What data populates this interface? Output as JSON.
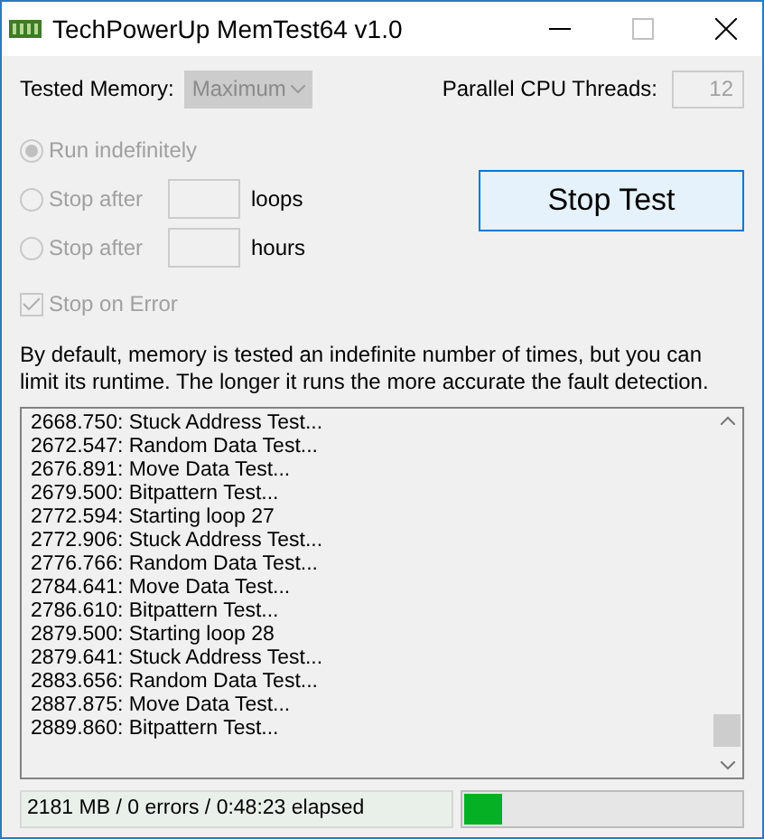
{
  "window": {
    "title": "TechPowerUp MemTest64 v1.0"
  },
  "tested_memory": {
    "label": "Tested Memory:",
    "value": "Maximum",
    "disabled": true
  },
  "threads": {
    "label": "Parallel CPU Threads:",
    "value": "12",
    "disabled": true
  },
  "run_options": [
    {
      "label": "Run indefinitely",
      "selected": true,
      "disabled": true
    },
    {
      "label": "Stop after",
      "unit": "loops",
      "selected": false,
      "disabled": true
    },
    {
      "label": "Stop after",
      "unit": "hours",
      "selected": false,
      "disabled": true
    }
  ],
  "stop_button": {
    "label": "Stop Test"
  },
  "stop_on_error": {
    "label": "Stop on Error",
    "checked": true,
    "disabled": true
  },
  "description": "By default, memory is tested an indefinite number of times, but you can limit its runtime. The longer it runs the more accurate the fault detection.",
  "log": [
    "2668.750: Stuck Address Test...",
    "2672.547: Random Data Test...",
    "2676.891: Move Data Test...",
    "2679.500: Bitpattern Test...",
    "2772.594: Starting loop 27",
    "2772.906: Stuck Address Test...",
    "2776.766: Random Data Test...",
    "2784.641: Move Data Test...",
    "2786.610: Bitpattern Test...",
    "2879.500: Starting loop 28",
    "2879.641: Stuck Address Test...",
    "2883.656: Random Data Test...",
    "2887.875: Move Data Test...",
    "2889.860: Bitpattern Test..."
  ],
  "status": {
    "text": "2181 MB / 0 errors / 0:48:23 elapsed",
    "level": 0.14
  }
}
